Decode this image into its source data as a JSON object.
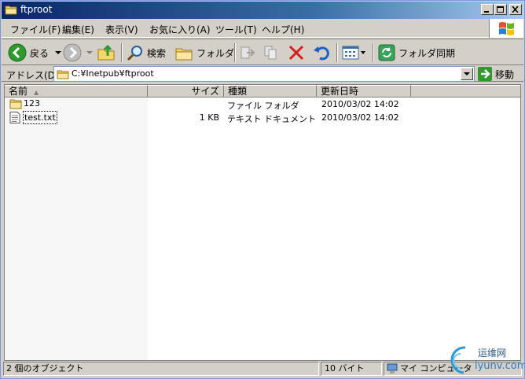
{
  "window": {
    "title": "ftproot"
  },
  "menu": {
    "items": [
      {
        "label": "ファイル(F)"
      },
      {
        "label": "編集(E)"
      },
      {
        "label": "表示(V)"
      },
      {
        "label": "お気に入り(A)"
      },
      {
        "label": "ツール(T)"
      },
      {
        "label": "ヘルプ(H)"
      }
    ]
  },
  "toolbar": {
    "back_label": "戻る",
    "search_label": "検索",
    "folders_label": "フォルダ",
    "sync_label": "フォルダ同期"
  },
  "address": {
    "label": "アドレス(D)",
    "value": "C:¥Inetpub¥ftproot",
    "go_label": "移動"
  },
  "list": {
    "columns": [
      {
        "label": "名前"
      },
      {
        "label": "サイズ"
      },
      {
        "label": "種類"
      },
      {
        "label": "更新日時"
      }
    ],
    "rows": [
      {
        "name": "123",
        "size": "",
        "type": "ファイル フォルダ",
        "modified": "2010/03/02 14:02",
        "icon": "folder-icon"
      },
      {
        "name": "test.txt",
        "size": "1 KB",
        "type": "テキスト ドキュメント",
        "modified": "2010/03/02 14:02",
        "icon": "text-file-icon"
      }
    ]
  },
  "statusbar": {
    "objects": "2 個のオブジェクト",
    "size": "10 バイト",
    "zone": "マイ コンピュータ"
  },
  "watermark": {
    "text_cn": "运维网",
    "text_url": "iyunv.com"
  },
  "colors": {
    "titlebar_start": "#0a246a",
    "titlebar_end": "#a6caf0",
    "face": "#d4d0c8",
    "back_green": "#2e9a2e",
    "delete_red": "#d42020",
    "go_green": "#2e9a2e"
  }
}
